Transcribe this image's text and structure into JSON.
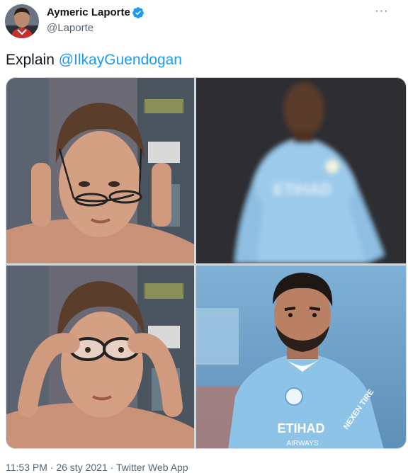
{
  "author": {
    "name": "Aymeric Laporte",
    "handle": "@Laporte",
    "verified": true,
    "avatar_icon": "player-avatar"
  },
  "more_icon": "more-options-icon",
  "tweet": {
    "text_prefix": "Explain ",
    "mention": "@IlkayGuendogan"
  },
  "media": {
    "panels": [
      {
        "name": "meme-glasses-off",
        "icon": "person-holding-glasses"
      },
      {
        "name": "blurry-player",
        "icon": "blurred-footballer"
      },
      {
        "name": "meme-glasses-on",
        "icon": "person-wearing-glasses"
      },
      {
        "name": "clear-player",
        "icon": "footballer-portrait"
      }
    ],
    "shirt_text_top": "ETIHAD",
    "shirt_text_bottom": "ETIHAD",
    "shirt_subtext": "AIRWAYS",
    "sleeve_text": "NEXEN TIRE"
  },
  "footer": {
    "time": "11:53 PM",
    "date": "26 sty 2021",
    "source": "Twitter Web App",
    "separator": " · "
  },
  "colors": {
    "link": "#1d9bf0",
    "secondary": "#536471",
    "city_blue": "#8ec3e8"
  }
}
